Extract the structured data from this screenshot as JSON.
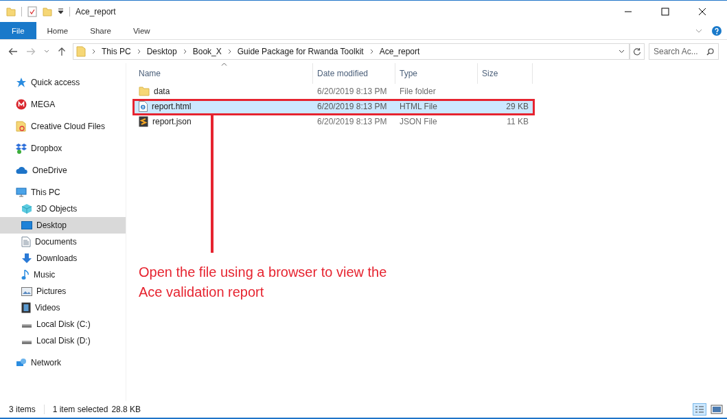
{
  "window": {
    "title": "Ace_report"
  },
  "ribbon_tabs": [
    {
      "label": "File",
      "selected": true
    },
    {
      "label": "Home",
      "selected": false
    },
    {
      "label": "Share",
      "selected": false
    },
    {
      "label": "View",
      "selected": false
    }
  ],
  "address_bar": {
    "path": [
      "This PC",
      "Desktop",
      "Book_X",
      "Guide Package for Rwanda Toolkit",
      "Ace_report"
    ]
  },
  "search": {
    "placeholder": "Search Ac..."
  },
  "sidebar": {
    "items": [
      {
        "label": "Quick access",
        "kind": "star",
        "selected": false
      },
      {
        "label": "MEGA",
        "kind": "mega",
        "selected": false
      },
      {
        "label": "Creative Cloud Files",
        "kind": "cc",
        "selected": false
      },
      {
        "label": "Dropbox",
        "kind": "dropbox",
        "selected": false
      },
      {
        "label": "OneDrive",
        "kind": "cloud",
        "selected": false
      },
      {
        "label": "This PC",
        "kind": "pc",
        "selected": false,
        "children": [
          {
            "label": "3D Objects",
            "kind": "cube",
            "selected": false
          },
          {
            "label": "Desktop",
            "kind": "desktop",
            "selected": true
          },
          {
            "label": "Documents",
            "kind": "documents",
            "selected": false
          },
          {
            "label": "Downloads",
            "kind": "downloads",
            "selected": false
          },
          {
            "label": "Music",
            "kind": "music",
            "selected": false
          },
          {
            "label": "Pictures",
            "kind": "pictures",
            "selected": false
          },
          {
            "label": "Videos",
            "kind": "videos",
            "selected": false
          },
          {
            "label": "Local Disk (C:)",
            "kind": "disk",
            "selected": false
          },
          {
            "label": "Local Disk (D:)",
            "kind": "disk",
            "selected": false
          }
        ]
      },
      {
        "label": "Network",
        "kind": "network",
        "selected": false
      }
    ]
  },
  "table": {
    "columns": [
      "Name",
      "Date modified",
      "Type",
      "Size"
    ],
    "rows": [
      {
        "name": "data",
        "date": "6/20/2019 8:13 PM",
        "type": "File folder",
        "kind": "folder",
        "selected": false
      },
      {
        "name": "report.html",
        "date": "6/20/2019 8:13 PM",
        "type": "HTML File",
        "size": "29 KB",
        "kind": "html",
        "selected": true
      },
      {
        "name": "report.json",
        "date": "6/20/2019 8:13 PM",
        "type": "JSON File",
        "size": "11 KB",
        "kind": "json",
        "selected": false
      }
    ]
  },
  "annotation": {
    "text": "Open the file using a browser to view the Ace validation report"
  },
  "status_bar": {
    "items": "3 items",
    "selection": "1 item selected",
    "size": "28.8 KB"
  }
}
